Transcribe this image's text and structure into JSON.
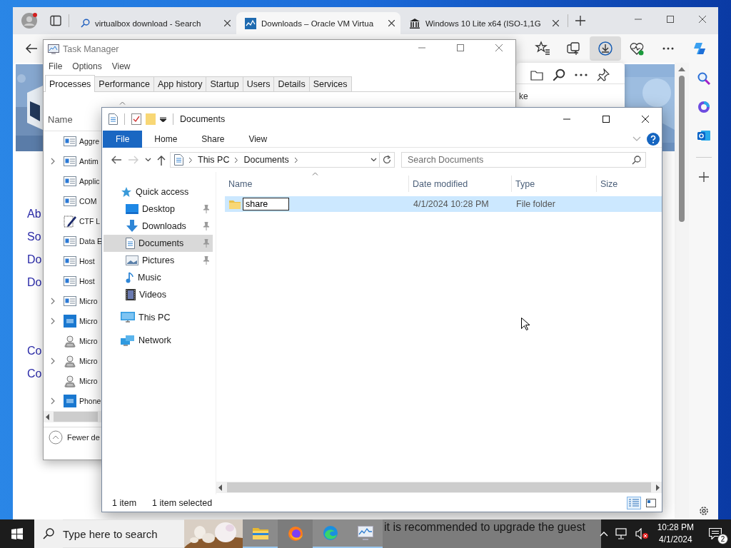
{
  "browser": {
    "tabs": [
      {
        "title": "virtualbox download - Search",
        "kind": "search",
        "selected": false
      },
      {
        "title": "Downloads – Oracle VM Virtua",
        "kind": "vbox",
        "selected": true
      },
      {
        "title": "Windows 10 Lite x64 (ISO-1,1G",
        "kind": "archive",
        "selected": false
      }
    ],
    "downloads_open": true,
    "downloads_panel": {
      "text": "ke"
    },
    "page_links": [
      [
        "Ab",
        "So",
        "Do",
        "Do"
      ],
      [
        "Co",
        "Co"
      ]
    ],
    "page_text": "it is recommended to upgrade the guest"
  },
  "task_manager": {
    "title": "Task Manager",
    "menu": [
      "File",
      "Options",
      "View"
    ],
    "tabs": [
      {
        "label": "Processes",
        "selected": true
      },
      {
        "label": "Performance",
        "selected": false
      },
      {
        "label": "App history",
        "selected": false
      },
      {
        "label": "Startup",
        "selected": false
      },
      {
        "label": "Users",
        "selected": false
      },
      {
        "label": "Details",
        "selected": false
      },
      {
        "label": "Services",
        "selected": false
      }
    ],
    "column": "Name",
    "rows": [
      {
        "name": "Aggre",
        "expandable": false,
        "kind": "app"
      },
      {
        "name": "Antim",
        "expandable": true,
        "kind": "app"
      },
      {
        "name": "Applic",
        "expandable": false,
        "kind": "app"
      },
      {
        "name": "COM",
        "expandable": false,
        "kind": "app"
      },
      {
        "name": "CTF L",
        "expandable": false,
        "kind": "edit"
      },
      {
        "name": "Data E",
        "expandable": false,
        "kind": "app"
      },
      {
        "name": "Host",
        "expandable": false,
        "kind": "app"
      },
      {
        "name": "Host",
        "expandable": false,
        "kind": "app"
      },
      {
        "name": "Micro",
        "expandable": true,
        "kind": "app"
      },
      {
        "name": "Micro",
        "expandable": true,
        "kind": "tile"
      },
      {
        "name": "Micro",
        "expandable": false,
        "kind": "user"
      },
      {
        "name": "Micro",
        "expandable": true,
        "kind": "user"
      },
      {
        "name": "Micro",
        "expandable": false,
        "kind": "user"
      },
      {
        "name": "Phone",
        "expandable": true,
        "kind": "tile"
      }
    ],
    "footer": "Fewer de"
  },
  "explorer": {
    "title": "Documents",
    "ribbon_tabs": [
      {
        "label": "File",
        "selected": true
      },
      {
        "label": "Home",
        "selected": false
      },
      {
        "label": "Share",
        "selected": false
      },
      {
        "label": "View",
        "selected": false
      }
    ],
    "breadcrumb": [
      "This PC",
      "Documents"
    ],
    "search": {
      "placeholder": "Search Documents"
    },
    "nav": [
      {
        "label": "Quick access",
        "kind": "quick",
        "selected": false,
        "children": [
          {
            "label": "Desktop",
            "kind": "desktop",
            "pinned": true,
            "selected": false
          },
          {
            "label": "Downloads",
            "kind": "downloads",
            "pinned": true,
            "selected": false
          },
          {
            "label": "Documents",
            "kind": "documents",
            "pinned": true,
            "selected": true
          },
          {
            "label": "Pictures",
            "kind": "pictures",
            "pinned": true,
            "selected": false
          },
          {
            "label": "Music",
            "kind": "music",
            "pinned": false,
            "selected": false
          },
          {
            "label": "Videos",
            "kind": "videos",
            "pinned": false,
            "selected": false
          }
        ]
      },
      {
        "label": "This PC",
        "kind": "pc",
        "selected": false
      },
      {
        "label": "Network",
        "kind": "network",
        "selected": false
      }
    ],
    "columns": [
      {
        "label": "Name",
        "sorted": true
      },
      {
        "label": "Date modified",
        "sorted": false
      },
      {
        "label": "Type",
        "sorted": false
      },
      {
        "label": "Size",
        "sorted": false
      }
    ],
    "rows": [
      {
        "name": "share",
        "date": "4/1/2024 10:28 PM",
        "type": "File folder",
        "selected": true,
        "renaming": true
      }
    ],
    "status": [
      "1 item",
      "1 item selected"
    ]
  },
  "taskbar": {
    "search": {
      "placeholder": "Type here to search"
    },
    "apps": [
      {
        "kind": "explorer",
        "running": true
      },
      {
        "kind": "firefox",
        "running": false
      },
      {
        "kind": "edge",
        "running": true
      },
      {
        "kind": "taskmgr",
        "running": true
      }
    ],
    "time": "10:28 PM",
    "date": "4/1/2024",
    "notifications": "2"
  }
}
